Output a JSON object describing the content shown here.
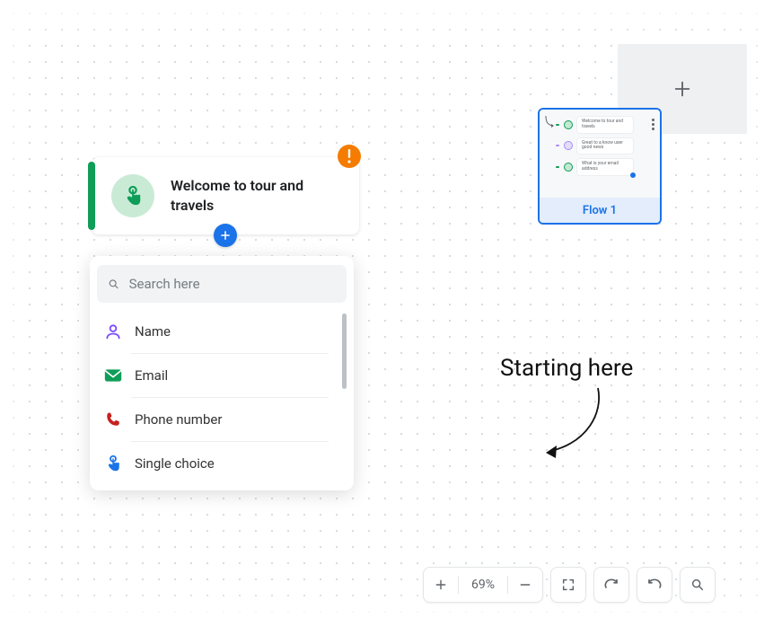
{
  "node": {
    "title": "Welcome to tour and travels"
  },
  "dropdown": {
    "search_placeholder": "Search here",
    "options": {
      "name": "Name",
      "email": "Email",
      "phone": "Phone number",
      "single_choice": "Single choice"
    }
  },
  "flow_card": {
    "label": "Flow 1",
    "preview_rows": {
      "r1": "Welcome to tour and travels",
      "r2": "Great to a know user good news",
      "r3": "What is your email address"
    }
  },
  "annotation": {
    "text": "Starting here"
  },
  "toolbar": {
    "zoom": "69%"
  }
}
